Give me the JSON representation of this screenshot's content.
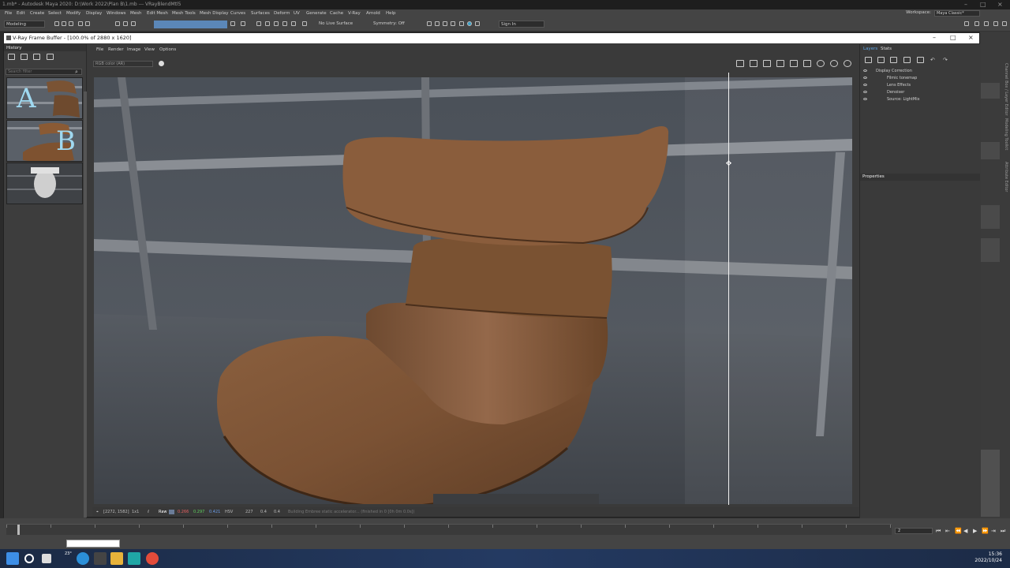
{
  "maya": {
    "title": "1.mb* - Autodesk Maya 2020: D:\\Work 2022\\Plan B\\1.mb   ---   VRayBlendMtl5",
    "menu": [
      "File",
      "Edit",
      "Create",
      "Select",
      "Modify",
      "Display",
      "Windows",
      "Mesh",
      "Edit Mesh",
      "Mesh Tools",
      "Mesh Display",
      "Curves",
      "Surfaces",
      "Deform",
      "UV",
      "Generate",
      "Cache",
      "V-Ray",
      "Arnold",
      "Help"
    ],
    "workspace_label": "Workspace:",
    "workspace_value": "Maya Classic*",
    "mode": "Modeling",
    "live_surface": "No Live Surface",
    "symmetry": "Symmetry: Off",
    "sign_in": "Sign In"
  },
  "vfb": {
    "title": "V-Ray Frame Buffer - [100.0% of 2880 x 1620]",
    "menu": [
      "File",
      "Render",
      "Image",
      "View",
      "Options"
    ],
    "channel": "RGB color (AR)"
  },
  "history": {
    "header": "History",
    "filter_placeholder": "Search filter",
    "thumbs": [
      {
        "label": "A"
      },
      {
        "label": "B"
      },
      {
        "label": ""
      }
    ]
  },
  "layers": {
    "tab_layers": "Layers",
    "tab_stats": "Stats",
    "items": [
      {
        "name": "Display Correction",
        "indent": 0
      },
      {
        "name": "Filmic tonemap",
        "indent": 2
      },
      {
        "name": "Lens Effects",
        "indent": 1
      },
      {
        "name": "Denoiser",
        "indent": 1
      },
      {
        "name": "Source: LightMix",
        "indent": 1
      }
    ],
    "properties": "Properties"
  },
  "status": {
    "coords": "[2272, 1582]",
    "zoom": "1x1",
    "mode": "Raw",
    "r": "0.266",
    "g": "0.297",
    "b": "0.421",
    "hsv": "HSV",
    "h": "227",
    "s": "0.4",
    "v": "0.4",
    "message": "Building Embree static accelerator... (finished in 0 [0h 0m 0.0s])"
  },
  "timeline": {
    "frame": "2"
  },
  "taskbar": {
    "weather": "23°",
    "time": "15:36",
    "date": "2022/10/24"
  },
  "colors": {
    "vfb_title_bg": "#ffffff",
    "panel_bg": "#3a3a3a",
    "maya_ui": "#444444",
    "selection_blue": "#5b87b8"
  }
}
